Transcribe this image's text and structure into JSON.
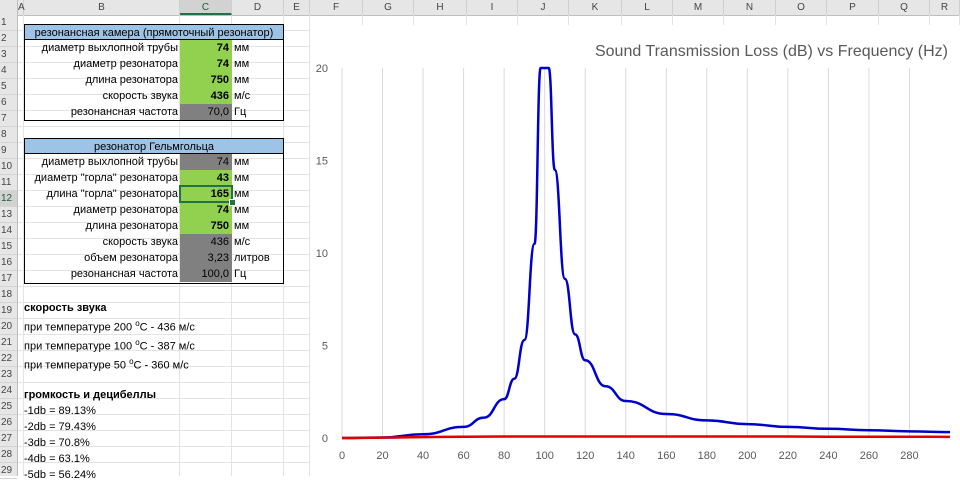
{
  "columns": [
    "A",
    "B",
    "C",
    "D",
    "E",
    "F",
    "G",
    "H",
    "I",
    "J",
    "K",
    "L",
    "M",
    "N",
    "O",
    "P",
    "Q",
    "R"
  ],
  "rows": [
    "1",
    "2",
    "3",
    "4",
    "5",
    "6",
    "7",
    "8",
    "9",
    "10",
    "11",
    "12",
    "13",
    "14",
    "15",
    "16",
    "17",
    "18",
    "19",
    "20",
    "21",
    "22",
    "23",
    "24",
    "25",
    "26",
    "27",
    "28",
    "29"
  ],
  "selected_cell": {
    "column": "C",
    "row": "12"
  },
  "table1": {
    "header": "резонансная камера (прямоточный резонатор)",
    "rows": [
      {
        "label": "диаметр выхлопной трубы",
        "value": "74",
        "unit": "мм",
        "fill": "green"
      },
      {
        "label": "диаметр резонатора",
        "value": "74",
        "unit": "мм",
        "fill": "green"
      },
      {
        "label": "длина резонатора",
        "value": "750",
        "unit": "мм",
        "fill": "green"
      },
      {
        "label": "скорость звука",
        "value": "436",
        "unit": "м/с",
        "fill": "green"
      },
      {
        "label": "резонансная частота",
        "value": "70,0",
        "unit": "Гц",
        "fill": "gray"
      }
    ]
  },
  "table2": {
    "header": "резонатор Гельмгольца",
    "rows": [
      {
        "label": "диаметр выхлопной трубы",
        "value": "74",
        "unit": "мм",
        "fill": "gray"
      },
      {
        "label": "диаметр \"горла\" резонатора",
        "value": "43",
        "unit": "мм",
        "fill": "green"
      },
      {
        "label": "длина \"горла\" резонатора",
        "value": "165",
        "unit": "мм",
        "fill": "green"
      },
      {
        "label": "диаметр резонатора",
        "value": "74",
        "unit": "мм",
        "fill": "green"
      },
      {
        "label": "длина резонатора",
        "value": "750",
        "unit": "мм",
        "fill": "green"
      },
      {
        "label": "скорость звука",
        "value": "436",
        "unit": "м/с",
        "fill": "gray"
      },
      {
        "label": "объем резонатора",
        "value": "3,23",
        "unit": "литров",
        "fill": "gray"
      },
      {
        "label": "резонансная частота",
        "value": "100,0",
        "unit": "Гц",
        "fill": "gray"
      }
    ]
  },
  "notes": {
    "sound_title": "скорость звука",
    "sound_lines": [
      {
        "pre": "при температуре 200 ",
        "sup": "о",
        "post": "С - 436 м/с"
      },
      {
        "pre": "при температуре 100 ",
        "sup": "о",
        "post": "С - 387 м/с"
      },
      {
        "pre": "при температуре 50 ",
        "sup": "о",
        "post": "С - 360 м/с"
      }
    ],
    "db_title": "громкость и децибеллы",
    "db_lines": [
      "-1db = 89.13%",
      "-2db = 79.43%",
      "-3db = 70.8%",
      "-4db = 63.1%",
      "-5db = 56.24%"
    ]
  },
  "colors": {
    "accent": "#217346",
    "header_fill": "#9dc3e6",
    "green_fill": "#92d050",
    "gray_fill": "#808080"
  },
  "chart_data": {
    "type": "line",
    "title": "Sound Transmission Loss (dB) vs Frequency (Hz)",
    "xlabel": "",
    "ylabel": "",
    "xlim": [
      0,
      300
    ],
    "ylim": [
      0,
      20
    ],
    "xticks": [
      0,
      20,
      40,
      60,
      80,
      100,
      120,
      140,
      160,
      180,
      200,
      220,
      240,
      260,
      280
    ],
    "yticks": [
      0,
      5,
      10,
      15,
      20
    ],
    "grid": "vertical",
    "series": [
      {
        "color": "#0000cc",
        "x": [
          0,
          20,
          40,
          60,
          70,
          80,
          85,
          90,
          95,
          98,
          100,
          102,
          105,
          110,
          115,
          120,
          130,
          140,
          160,
          180,
          200,
          220,
          240,
          260,
          280,
          300
        ],
        "y": [
          0,
          0.03,
          0.2,
          0.6,
          1.1,
          2.1,
          3.2,
          5.3,
          10.5,
          20,
          20,
          20,
          14.5,
          8.6,
          5.6,
          4.2,
          2.8,
          2.0,
          1.3,
          0.95,
          0.75,
          0.6,
          0.5,
          0.42,
          0.36,
          0.32
        ]
      },
      {
        "color": "#e00000",
        "x": [
          0,
          20,
          40,
          60,
          80,
          100,
          120,
          140,
          160,
          180,
          200,
          220,
          240,
          260,
          280,
          300
        ],
        "y": [
          0,
          0.02,
          0.05,
          0.07,
          0.08,
          0.08,
          0.08,
          0.08,
          0.08,
          0.08,
          0.08,
          0.08,
          0.07,
          0.07,
          0.07,
          0.06
        ]
      }
    ]
  }
}
